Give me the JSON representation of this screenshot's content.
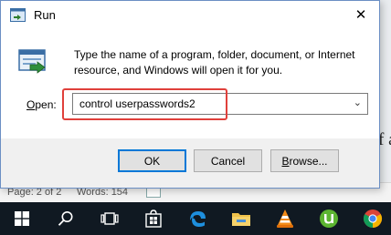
{
  "background": {
    "doc_text_fragment": "f a",
    "status_page": "Page: 2 of 2",
    "status_words": "Words: 154"
  },
  "dialog": {
    "title": "Run",
    "close_glyph": "✕",
    "description": "Type the name of a program, folder, document, or Internet resource, and Windows will open it for you.",
    "open_label_accel": "O",
    "open_label_rest": "pen:",
    "command_value": "control userpasswords2",
    "dropdown_glyph": "⌄",
    "highlight_color": "#e0403b",
    "buttons": {
      "ok": "OK",
      "cancel": "Cancel",
      "browse_accel": "B",
      "browse_rest": "rowse..."
    }
  },
  "taskbar": {
    "items": [
      "windows-start-icon",
      "search-icon",
      "task-view-icon",
      "store-icon",
      "edge-icon",
      "file-explorer-icon",
      "vlc-icon",
      "utorrent-icon",
      "chrome-icon"
    ],
    "background": "#101922"
  }
}
